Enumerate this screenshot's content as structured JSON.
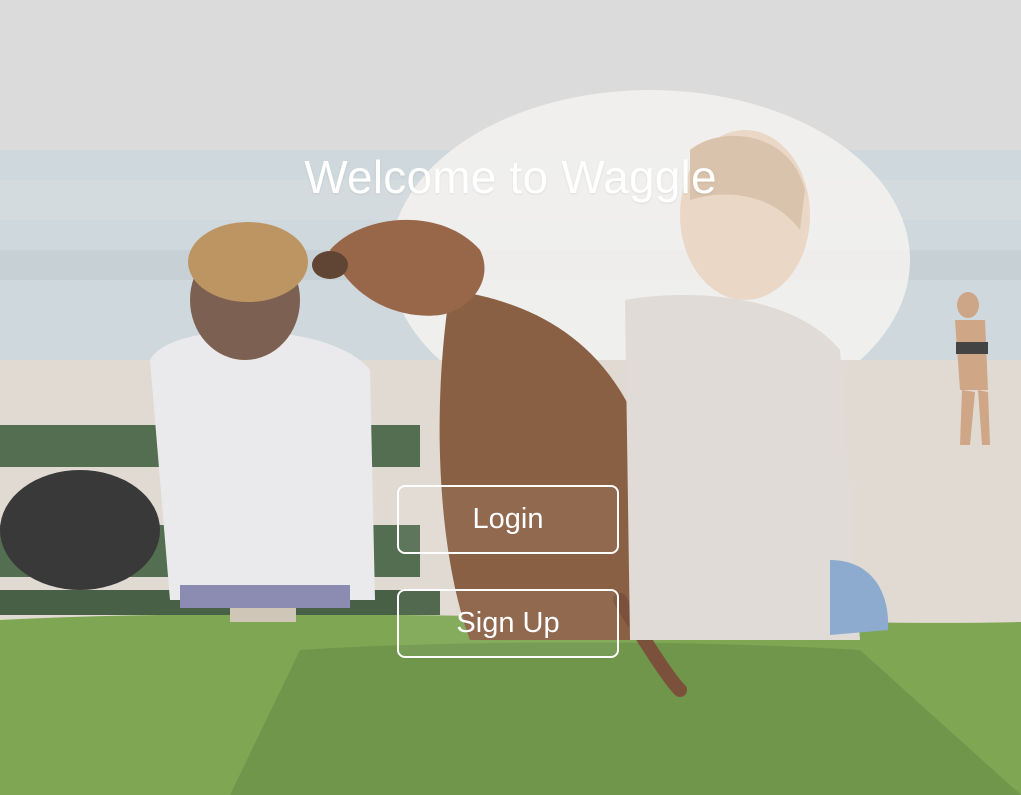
{
  "page": {
    "title": "Welcome to Waggle"
  },
  "actions": {
    "login_label": "Login",
    "signup_label": "Sign Up"
  },
  "colors": {
    "text": "#ffffff",
    "button_border": "#ffffff",
    "sky": "#d6d6d6",
    "sea": "#c9d3d8",
    "sand": "#ddd5cc",
    "grass": "#6d9a3c"
  },
  "background": {
    "description_icon": "beach-photo-icon"
  }
}
